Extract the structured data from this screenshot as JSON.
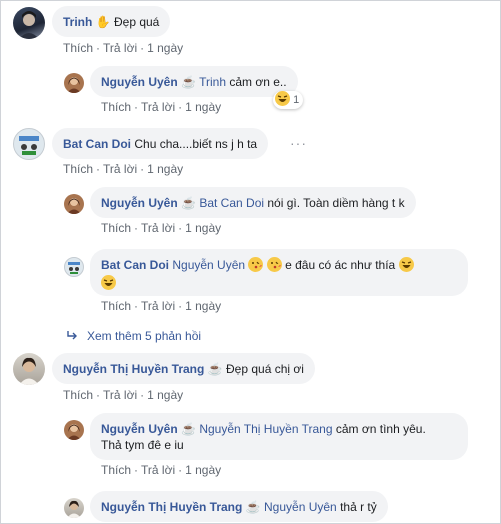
{
  "actions": {
    "like": "Thích",
    "reply": "Trả lời",
    "sep": "·",
    "time": "1 ngày"
  },
  "comments": [
    {
      "author": "Trinh",
      "badge": "wave-hand-icon",
      "text": "Đẹp quá"
    },
    {
      "author": "Nguyễn Uyên",
      "badge": "coffee-icon",
      "mention": "Trinh",
      "text": "cảm ơn e..",
      "reaction_count": "1"
    },
    {
      "author": "Bat Can Doi",
      "text": "Chu cha....biết ns j h ta",
      "more": "···"
    },
    {
      "author": "Nguyễn Uyên",
      "badge": "coffee-icon",
      "mention": "Bat Can Doi",
      "text": "nói gì. Toàn diềm hàng t k"
    },
    {
      "author": "Bat Can Doi",
      "mention": "Nguyễn Uyên",
      "text": "e đâu có ác như thía"
    },
    {
      "author": "Nguyễn Thị Huyền Trang",
      "badge": "coffee-icon",
      "text": "Đẹp quá chị ơi"
    },
    {
      "author": "Nguyễn Uyên",
      "badge": "coffee-icon",
      "mention": "Nguyễn Thị Huyền Trang",
      "text": "cảm ơn tình yêu.",
      "text2": "Thả tym đê e iu"
    },
    {
      "author": "Nguyễn Thị Huyền Trang",
      "badge": "coffee-icon",
      "mention": "Nguyễn Uyên",
      "text": "thả r tỷ"
    }
  ],
  "see_more": {
    "label": "Xem thêm 5 phản hồi"
  },
  "colors": {
    "link": "#385898",
    "bubble": "#f2f3f5",
    "meta": "#606770"
  }
}
